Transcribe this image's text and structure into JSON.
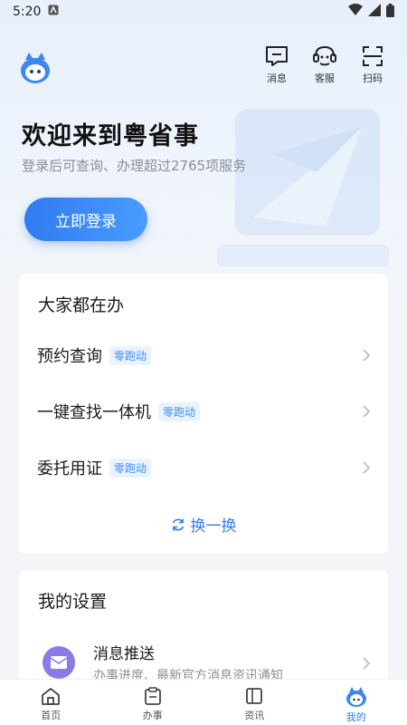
{
  "status_bar": {
    "time": "5:20"
  },
  "top_bar": {
    "actions": [
      {
        "label": "消息",
        "icon": "message-icon"
      },
      {
        "label": "客服",
        "icon": "customer-service-icon"
      },
      {
        "label": "扫码",
        "icon": "scan-icon"
      }
    ]
  },
  "hero": {
    "title": "欢迎来到粤省事",
    "subtitle": "登录后可查询、办理超过2765项服务",
    "login_button": "立即登录"
  },
  "popular": {
    "title": "大家都在办",
    "items": [
      {
        "name": "预约查询",
        "tag": "零跑动"
      },
      {
        "name": "一键查找一体机",
        "tag": "零跑动"
      },
      {
        "name": "委托用证",
        "tag": "零跑动"
      }
    ],
    "refresh_label": "换一换"
  },
  "settings": {
    "title": "我的设置",
    "items": [
      {
        "title": "消息推送",
        "desc": "办事进度、最新官方消息资讯通知"
      }
    ]
  },
  "tabs": [
    {
      "label": "首页",
      "icon": "home-icon",
      "active": false
    },
    {
      "label": "办事",
      "icon": "clipboard-icon",
      "active": false
    },
    {
      "label": "资讯",
      "icon": "news-icon",
      "active": false
    },
    {
      "label": "我的",
      "icon": "mascot-icon",
      "active": true
    }
  ],
  "colors": {
    "accent": "#2f7cf0",
    "tag_bg": "#e9f3ff",
    "tag_text": "#3b8ef2",
    "settings_icon": "#8b79e8"
  }
}
